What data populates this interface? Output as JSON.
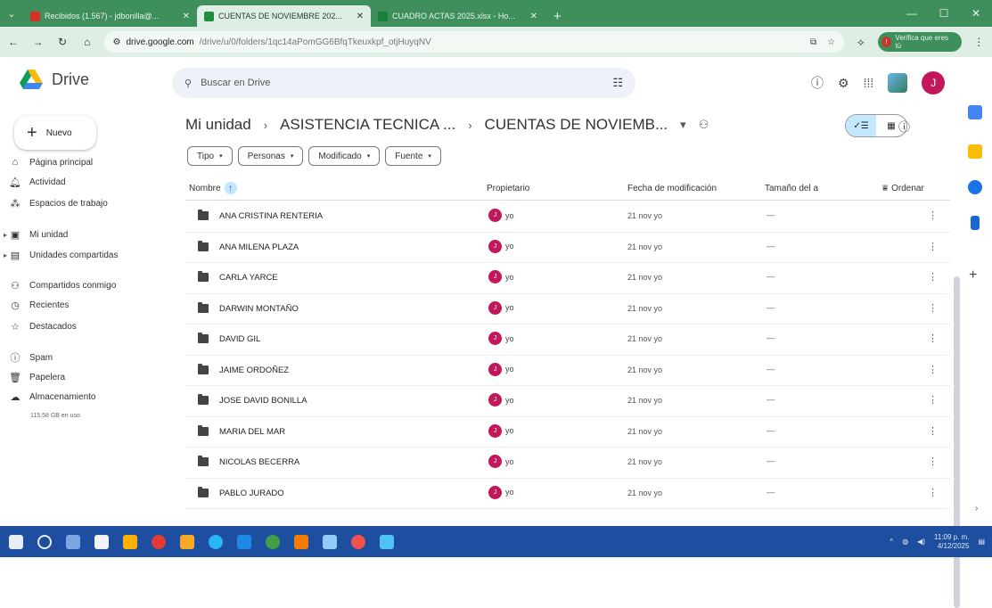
{
  "browser": {
    "tabs": [
      {
        "title": "Recibidos (1.567) - jdbonilla@...",
        "active": false,
        "favicon_color": "#d93025"
      },
      {
        "title": "CUENTAS DE NOVIEMBRE 202...",
        "active": true,
        "favicon_color": "#1e8e3e"
      },
      {
        "title": "CUADRO ACTAS 2025.xlsx - Ho...",
        "active": false,
        "favicon_color": "#188038"
      }
    ],
    "url_host": "drive.google.com",
    "url_path": "/drive/u/0/folders/1qc14aPomGG6BfqTkeuxkpf_otjHuyqNV",
    "verify_label": "Verifica que eres tú"
  },
  "drive": {
    "logo_text": "Drive",
    "search_placeholder": "Buscar en Drive",
    "user_initial": "J"
  },
  "sidebar": {
    "new_label": "Nuevo",
    "items": [
      {
        "label": "Página principal",
        "icon": "home-icon"
      },
      {
        "label": "Actividad",
        "icon": "bell-icon"
      },
      {
        "label": "Espacios de trabajo",
        "icon": "workspaces-icon"
      },
      {
        "label": "Mi unidad",
        "icon": "my-drive-icon"
      },
      {
        "label": "Unidades compartidas",
        "icon": "shared-drives-icon"
      },
      {
        "label": "Compartidos conmigo",
        "icon": "shared-with-me-icon"
      },
      {
        "label": "Recientes",
        "icon": "clock-icon"
      },
      {
        "label": "Destacados",
        "icon": "star-icon"
      },
      {
        "label": "Spam",
        "icon": "spam-icon"
      },
      {
        "label": "Papelera",
        "icon": "trash-icon"
      },
      {
        "label": "Almacenamiento",
        "icon": "cloud-icon"
      }
    ],
    "storage_used": "115,58 GB en uso"
  },
  "breadcrumb": {
    "root": "Mi unidad",
    "middle": "ASISTENCIA TECNICA ...",
    "current": "CUENTAS DE NOVIEMB..."
  },
  "filters": [
    "Tipo",
    "Personas",
    "Modificado",
    "Fuente"
  ],
  "columns": {
    "name": "Nombre",
    "owner": "Propietario",
    "modified": "Fecha de modificación",
    "size": "Tamaño del a",
    "sort": "Ordenar"
  },
  "files": [
    {
      "name": "ANA CRISTINA RENTERIA",
      "owner": "yo",
      "modified": "21 nov yo",
      "size": "—"
    },
    {
      "name": "ANA MILENA PLAZA",
      "owner": "yo",
      "modified": "21 nov yo",
      "size": "—"
    },
    {
      "name": "CARLA YARCE",
      "owner": "yo",
      "modified": "21 nov yo",
      "size": "—"
    },
    {
      "name": "DARWIN MONTAÑO",
      "owner": "yo",
      "modified": "21 nov yo",
      "size": "—"
    },
    {
      "name": "DAVID GIL",
      "owner": "yo",
      "modified": "21 nov yo",
      "size": "—"
    },
    {
      "name": "JAIME ORDOÑEZ",
      "owner": "yo",
      "modified": "21 nov yo",
      "size": "—"
    },
    {
      "name": "JOSE DAVID BONILLA",
      "owner": "yo",
      "modified": "21 nov yo",
      "size": "—"
    },
    {
      "name": "MARIA DEL MAR",
      "owner": "yo",
      "modified": "21 nov yo",
      "size": "—"
    },
    {
      "name": "NICOLAS BECERRA",
      "owner": "yo",
      "modified": "21 nov yo",
      "size": "—"
    },
    {
      "name": "PABLO JURADO",
      "owner": "yo",
      "modified": "21 nov yo",
      "size": "—"
    }
  ],
  "taskbar": {
    "time": "11:09 p. m.",
    "date": "4/12/2025"
  },
  "colors": {
    "chrome_green": "#3f8f5c",
    "drive_accent": "#c2e7ff",
    "avatar": "#c2185b",
    "taskbar": "#1d4ea0"
  }
}
